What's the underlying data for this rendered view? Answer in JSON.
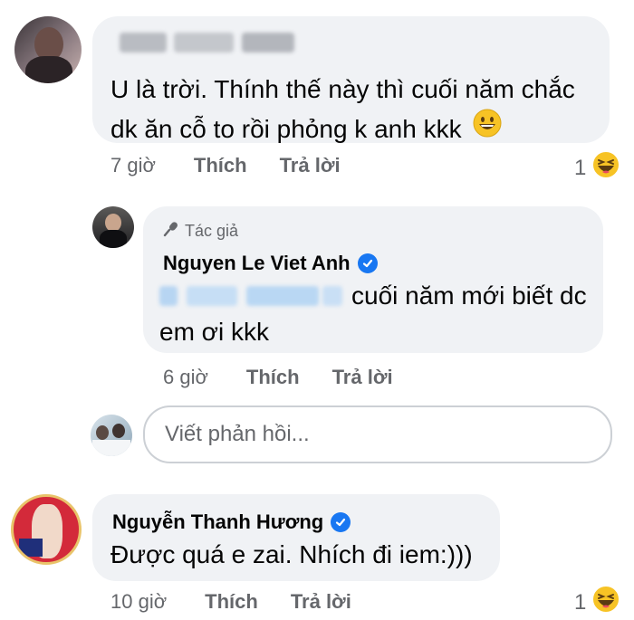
{
  "comments": [
    {
      "name_hidden": true,
      "text_line1": "U là trời. Thính thế này thì cuối năm chắc",
      "text_line2": "dk ăn cỗ to rồi phỏng k anh kkk",
      "emoji_icon": "grinning-face-icon",
      "time": "7 giờ",
      "like_label": "Thích",
      "reply_label": "Trả lời",
      "reaction_count": "1",
      "reaction_icon": "laughing-face-icon"
    },
    {
      "badge": "Tác giả",
      "badge_icon": "microphone-icon",
      "name": "Nguyen Le Viet Anh",
      "verified_icon": "verified-badge-icon",
      "text_line1": "cuối năm mới biết dc",
      "text_line2": "em ơi kkk",
      "time": "6 giờ",
      "like_label": "Thích",
      "reply_label": "Trả lời"
    },
    {
      "name": "Nguyễn Thanh Hương",
      "verified_icon": "verified-badge-icon",
      "text": "Được quá e zai. Nhích đi iem:)))",
      "time": "10 giờ",
      "like_label": "Thích",
      "reply_label": "Trả lời",
      "reaction_count": "1",
      "reaction_icon": "laughing-face-icon"
    }
  ],
  "reply_box": {
    "placeholder": "Viết phản hồi..."
  },
  "colors": {
    "bubble": "#f0f2f5",
    "meta_text": "#65676b",
    "verified": "#1877f2",
    "emoji": "#f7c325"
  }
}
